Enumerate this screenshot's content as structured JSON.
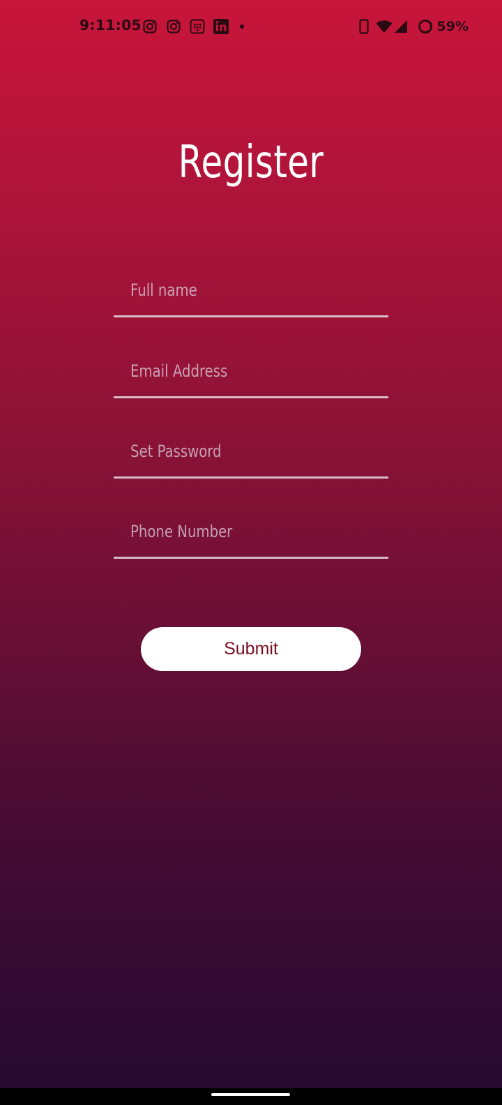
{
  "status_bar": {
    "time": "9:11:05",
    "battery": "59%",
    "notification_icons": [
      "instagram-icon",
      "instagram-icon",
      "calendar-grid-icon",
      "linkedin-icon"
    ],
    "system_icons": [
      "phone-vibrate-icon",
      "wifi-icon",
      "cellular-signal-icon",
      "battery-ring-icon"
    ]
  },
  "form": {
    "title": "Register",
    "fields": [
      {
        "placeholder": "Full name",
        "value": ""
      },
      {
        "placeholder": "Email Address",
        "value": ""
      },
      {
        "placeholder": "Set Password",
        "value": ""
      },
      {
        "placeholder": "Phone Number",
        "value": ""
      }
    ],
    "submit_label": "Submit"
  },
  "colors": {
    "gradient_top": "#c8153a",
    "gradient_bottom": "#240a30",
    "submit_text": "#7a0d22",
    "field_underline": "#ebe1eb"
  }
}
